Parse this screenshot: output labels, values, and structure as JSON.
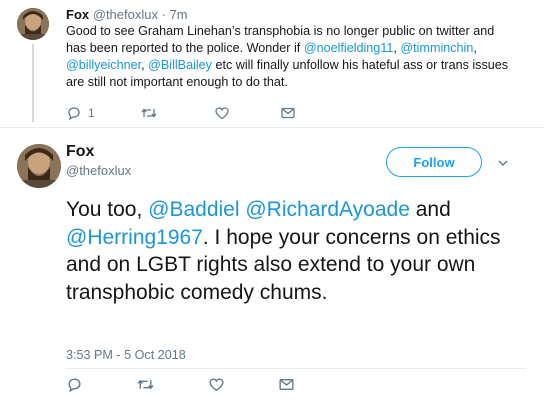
{
  "parent_tweet": {
    "name": "Fox",
    "handle": "@thefoxlux",
    "separator": "·",
    "time": "7m",
    "text_parts": [
      {
        "text": "Good to see Graham Linehan’s transphobia is no longer public on twitter and has been reported to the police. Wonder if ",
        "mention": false
      },
      {
        "text": "@noelfielding11",
        "mention": true
      },
      {
        "text": ", ",
        "mention": false
      },
      {
        "text": "@timminchin",
        "mention": true
      },
      {
        "text": ", ",
        "mention": false
      },
      {
        "text": "@billyeichner",
        "mention": true
      },
      {
        "text": ", ",
        "mention": false
      },
      {
        "text": "@BillBailey",
        "mention": true
      },
      {
        "text": " etc will finally unfollow his hateful ass or trans issues are still not important enough to do that.",
        "mention": false
      }
    ],
    "reply_count": "1",
    "actions": [
      "reply-icon",
      "retweet-icon",
      "like-icon",
      "message-icon"
    ]
  },
  "main_tweet": {
    "name": "Fox",
    "handle": "@thefoxlux",
    "follow_label": "Follow",
    "text_parts": [
      {
        "text": "You too, ",
        "mention": false
      },
      {
        "text": "@Baddiel",
        "mention": true
      },
      {
        "text": " ",
        "mention": false
      },
      {
        "text": "@RichardAyoade",
        "mention": true
      },
      {
        "text": " and ",
        "mention": false
      },
      {
        "text": "@Herring1967",
        "mention": true
      },
      {
        "text": ". I hope your concerns on ethics and on LGBT rights also extend to your own transphobic comedy chums.",
        "mention": false
      }
    ],
    "timestamp": "3:53 PM - 5 Oct 2018",
    "actions": [
      "reply-icon",
      "retweet-icon",
      "like-icon",
      "message-icon"
    ]
  },
  "colors": {
    "link": "#1b95e0",
    "follow": "#1da1f2",
    "muted": "#657786"
  }
}
